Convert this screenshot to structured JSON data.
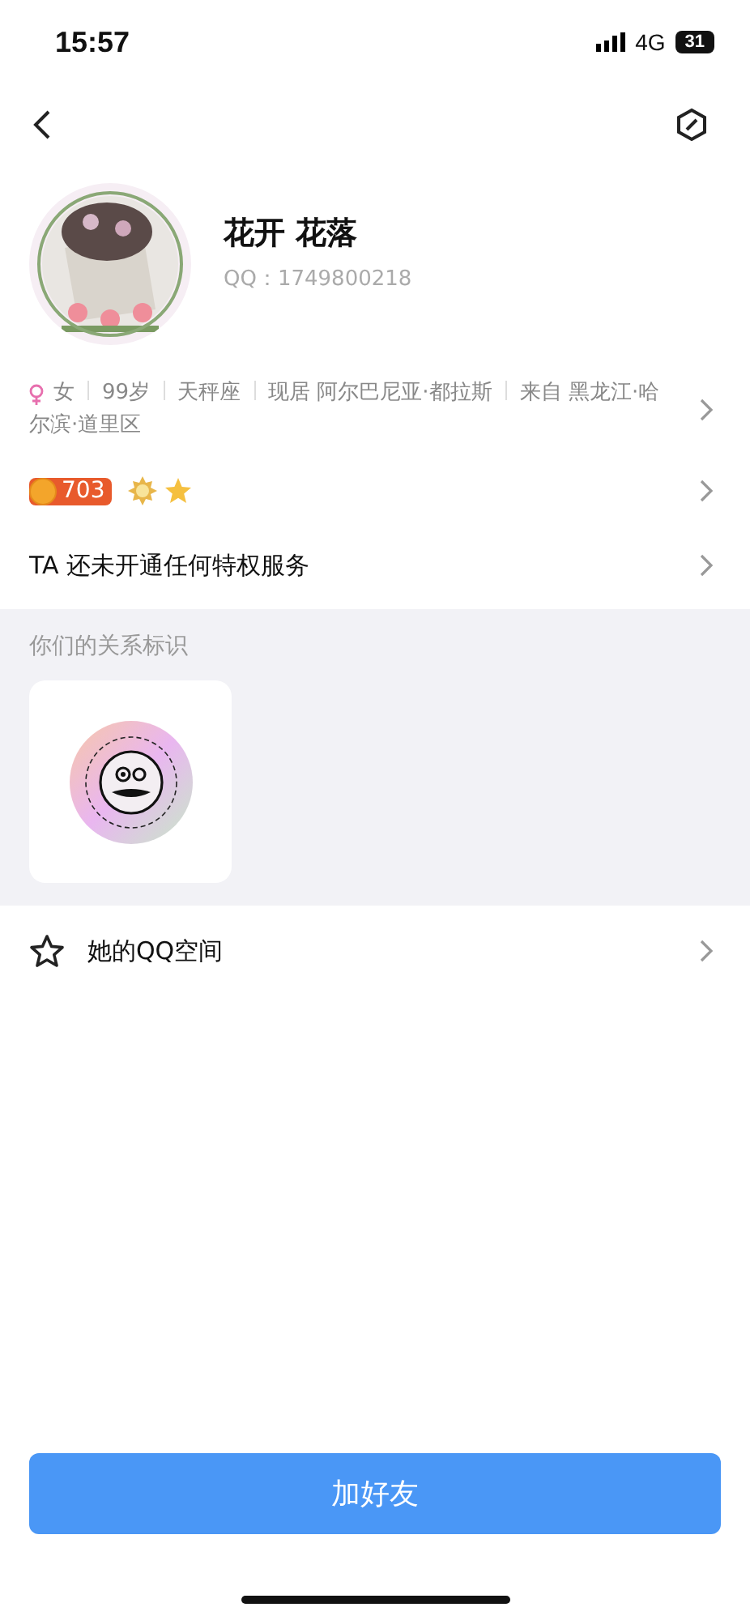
{
  "status_bar": {
    "time": "15:57",
    "network": "4G",
    "battery": "31"
  },
  "profile": {
    "name": "花开 花落",
    "qq": "QQ：1749800218"
  },
  "info": {
    "gender": "女",
    "items": [
      "99岁",
      "天秤座",
      "现居 阿尔巴尼亚·都拉斯",
      "来自 黑龙江·哈尔滨·道里区"
    ]
  },
  "level": {
    "value": "703"
  },
  "privilege": "TA 还未开通任何特权服务",
  "relation": {
    "title": "你们的关系标识"
  },
  "qzone": "她的QQ空间",
  "add_button": "加好友"
}
